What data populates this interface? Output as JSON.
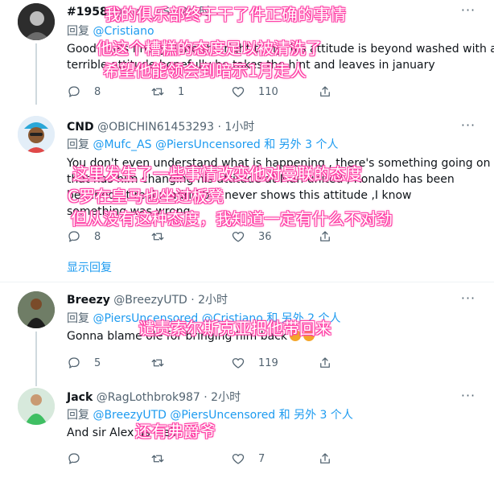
{
  "tweets": [
    {
      "name": "#1958",
      "meta": "@Mufc_AS · 2小时",
      "reply_prefix": "回复",
      "reply_links": "@Cristiano",
      "text_l1": "Good! He's finally done the right thing, his attitude is beyond washed with a",
      "text_l2": "terrible attitude hopefully he takes the hint and leaves in january",
      "counts": {
        "reply": "8",
        "retweet": "1",
        "like": "110"
      },
      "overlay": [
        "我的俱乐部终于干了件正确的事情",
        "他这个糟糕的态度足以被清洗了",
        "希望他能领会到暗示1月走人"
      ]
    },
    {
      "name": "CND",
      "meta": "@OBICHIN61453293 · 1小时",
      "reply_prefix": "回复",
      "reply_links": "@Mufc_AS @PiersUncensored",
      "reply_and": "和 另外 3 个人",
      "text_l1": "You don't even understand  what is happening , there's something going on",
      "text_l2": "that has him changing his attitude at Man united , Ronaldo has been",
      "text_l3": "benched at real madrid but never shows this attitude ,I know",
      "text_l4": "something was wrong",
      "counts": {
        "reply": "8",
        "retweet": "",
        "like": "36"
      },
      "show_replies": "显示回复",
      "overlay": [
        "这里发生了一些事情改变他对曼联的态度",
        "C罗在皇马也坐过板凳",
        "但从没有这种态度，我知道一定有什么不对劲"
      ]
    },
    {
      "name": "Breezy",
      "meta": "@BreezyUTD · 2小时",
      "reply_prefix": "回复",
      "reply_links": "@PiersUncensored @Cristiano",
      "reply_and": "和 另外 2 个人",
      "text_l1": "Gonna blame ole for bringing him back",
      "counts": {
        "reply": "5",
        "retweet": "",
        "like": "119"
      },
      "overlay": [
        "谴责索尔斯克亚把他带回来"
      ]
    },
    {
      "name": "Jack",
      "meta": "@RagLothbrok987 · 2小时",
      "reply_prefix": "回复",
      "reply_links": "@BreezyUTD @PiersUncensored",
      "reply_and": "和 另外 3 个人",
      "text_l1": "And sir Alex as well",
      "counts": {
        "reply": "",
        "retweet": "",
        "like": "7"
      },
      "overlay": [
        "还有弗爵爷"
      ]
    }
  ],
  "colors": {
    "accent": "#1d9bf0",
    "muted": "#536471",
    "overlay_outline": "#ff3ea5"
  }
}
